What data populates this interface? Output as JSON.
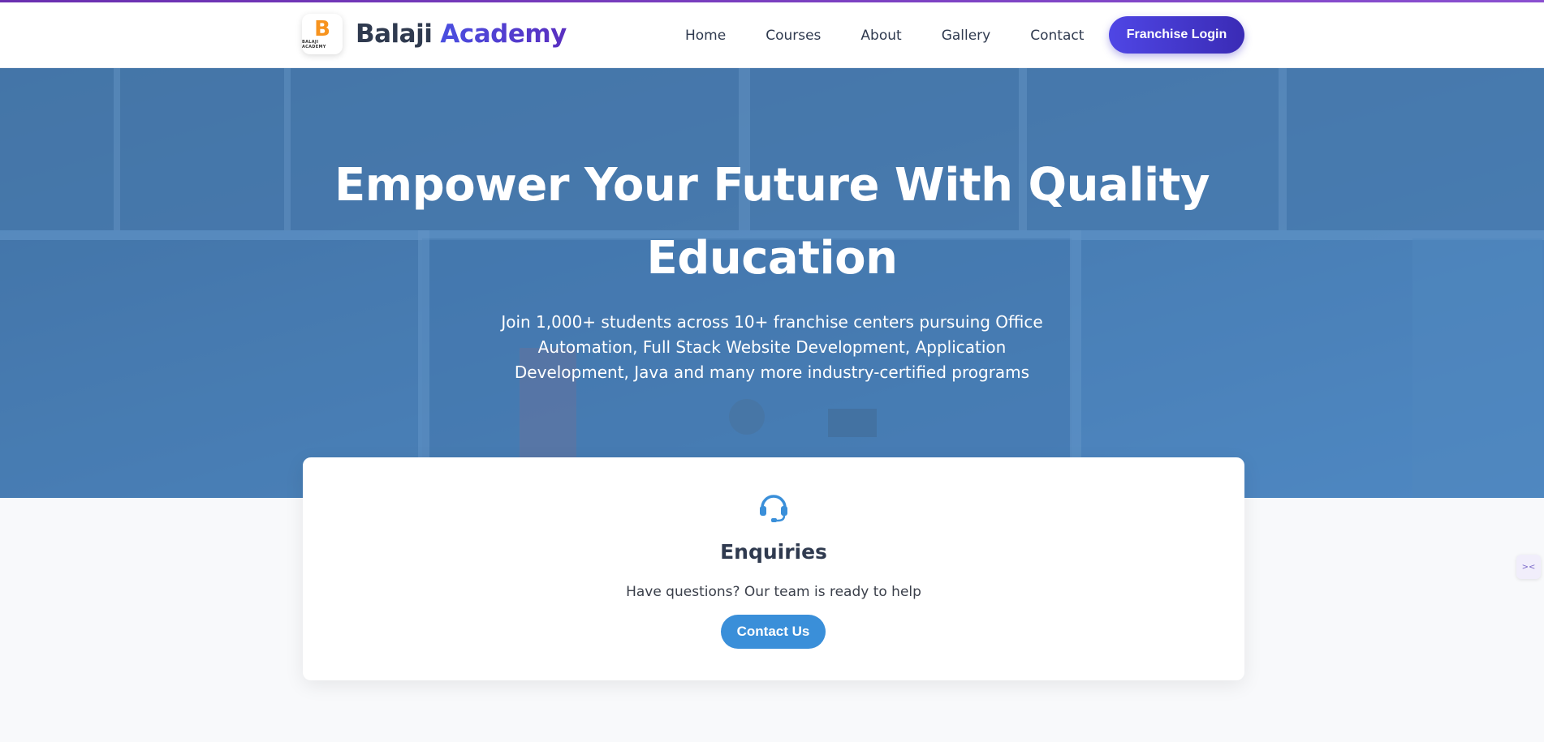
{
  "brand": {
    "logo_letter": "B",
    "logo_caption": "BALAJI ACADEMY",
    "name_part1": "Balaji",
    "name_part2": "Academy"
  },
  "nav": {
    "items": [
      {
        "label": "Home"
      },
      {
        "label": "Courses"
      },
      {
        "label": "About"
      },
      {
        "label": "Gallery"
      },
      {
        "label": "Contact"
      }
    ],
    "franchise_label": "Franchise Login"
  },
  "hero": {
    "title_line1": "Empower Your Future With Quality",
    "title_line2": "Education",
    "subtitle": "Join 1,000+ students across 10+ franchise centers pursuing Office Automation, Full Stack Website Development, Application Development, Java and many more industry-certified programs"
  },
  "enquiry_card": {
    "icon": "headset-icon",
    "title": "Enquiries",
    "text": "Have questions? Our team is ready to help",
    "button_label": "Contact Us"
  },
  "colors": {
    "accent_purple": "#4f46e5",
    "accent_blue": "#3a8fd9",
    "hero_tint": "#4a7fae",
    "logo_orange": "#f7931e"
  }
}
